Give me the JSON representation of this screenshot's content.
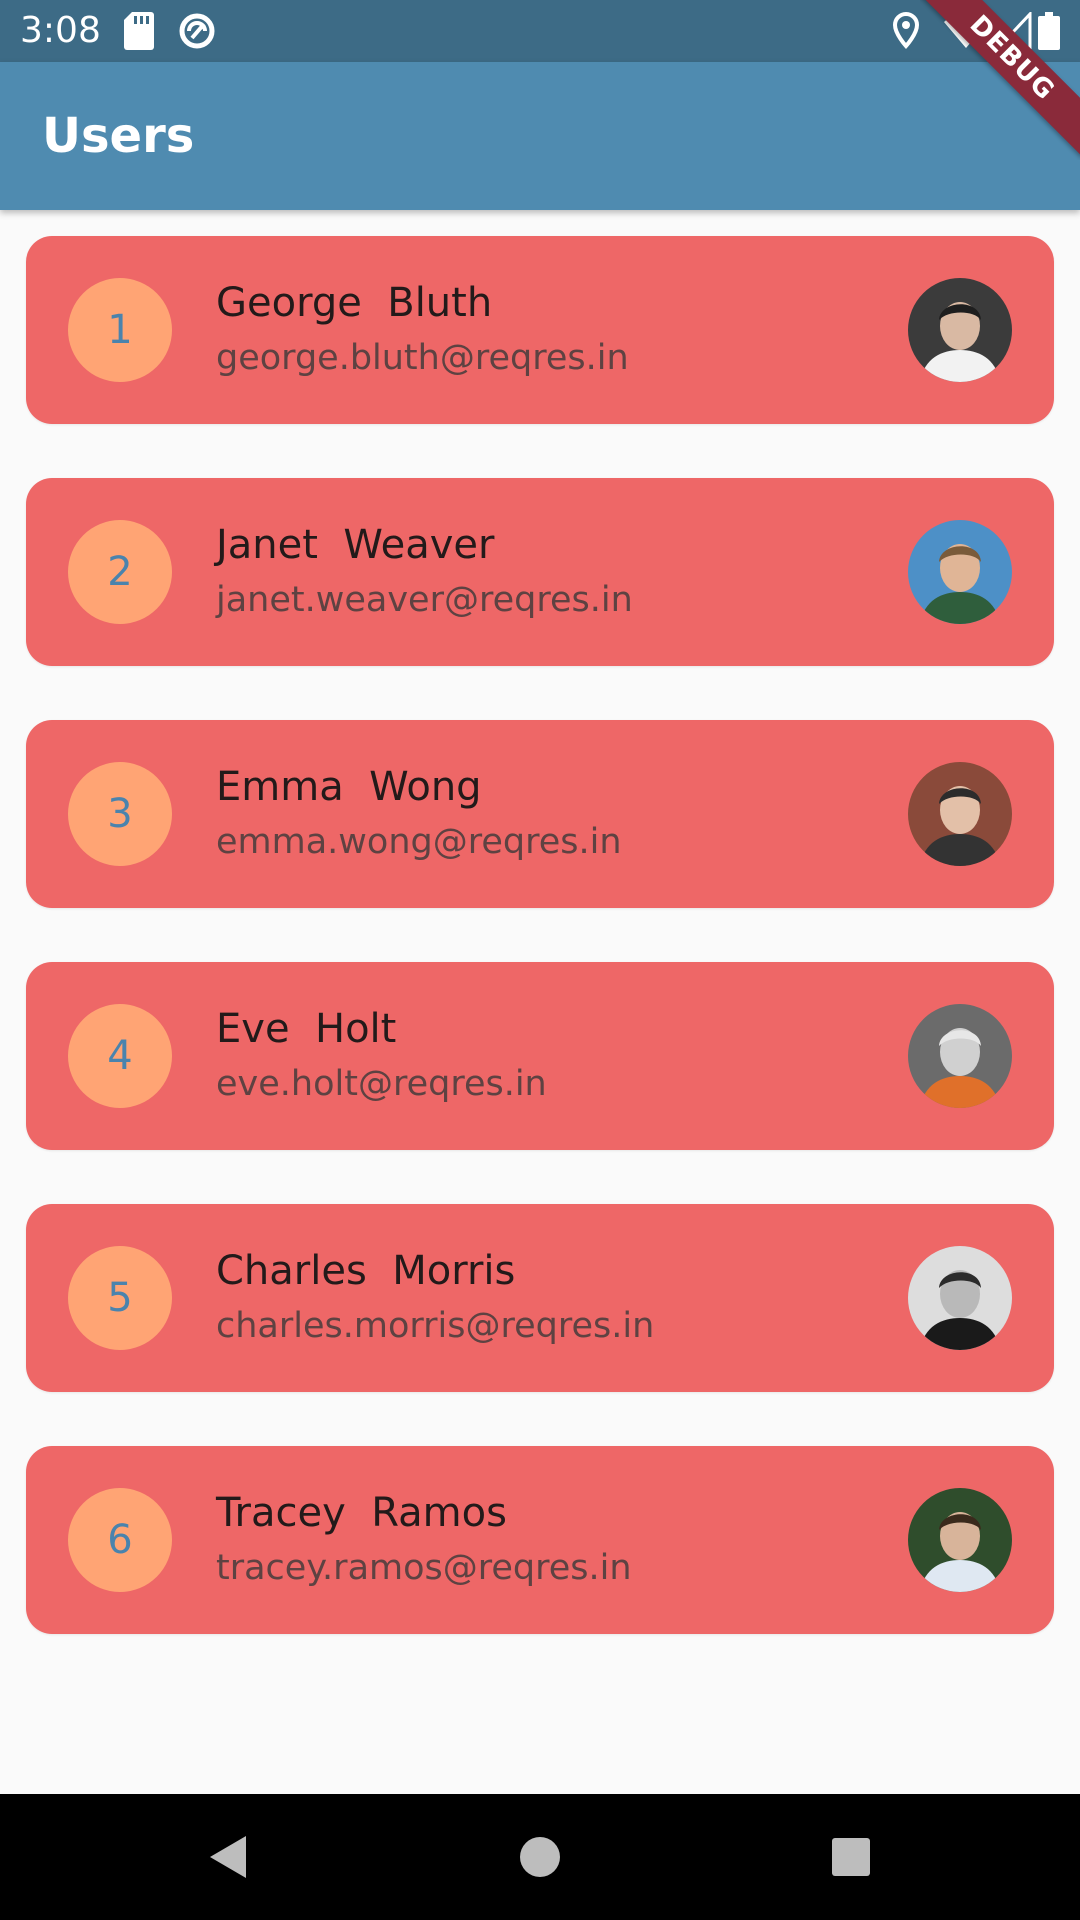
{
  "status_bar": {
    "time": "3:08",
    "left_icons": [
      "sd-card-icon",
      "sync-icon"
    ],
    "right_icons": [
      "location-icon",
      "wifi-icon",
      "signal-icon",
      "battery-icon"
    ]
  },
  "debug_banner": "DEBUG",
  "app_bar": {
    "title": "Users"
  },
  "colors": {
    "status_bar": "#3d6b86",
    "app_bar": "#4f8bb0",
    "card": "#ee6767",
    "id_circle": "#ffa474",
    "id_text": "#4a83ad",
    "background": "#fafafa"
  },
  "users": [
    {
      "id": "1",
      "name": "George  Bluth",
      "email": "george.bluth@reqres.in",
      "avatar_icon": "avatar-photo-icon"
    },
    {
      "id": "2",
      "name": "Janet  Weaver",
      "email": "janet.weaver@reqres.in",
      "avatar_icon": "avatar-photo-icon"
    },
    {
      "id": "3",
      "name": "Emma  Wong",
      "email": "emma.wong@reqres.in",
      "avatar_icon": "avatar-photo-icon"
    },
    {
      "id": "4",
      "name": "Eve  Holt",
      "email": "eve.holt@reqres.in",
      "avatar_icon": "avatar-photo-icon"
    },
    {
      "id": "5",
      "name": "Charles  Morris",
      "email": "charles.morris@reqres.in",
      "avatar_icon": "avatar-photo-icon"
    },
    {
      "id": "6",
      "name": "Tracey  Ramos",
      "email": "tracey.ramos@reqres.in",
      "avatar_icon": "avatar-photo-icon"
    }
  ],
  "nav_bar": {
    "icons": [
      "back-icon",
      "home-icon",
      "recents-icon"
    ]
  }
}
